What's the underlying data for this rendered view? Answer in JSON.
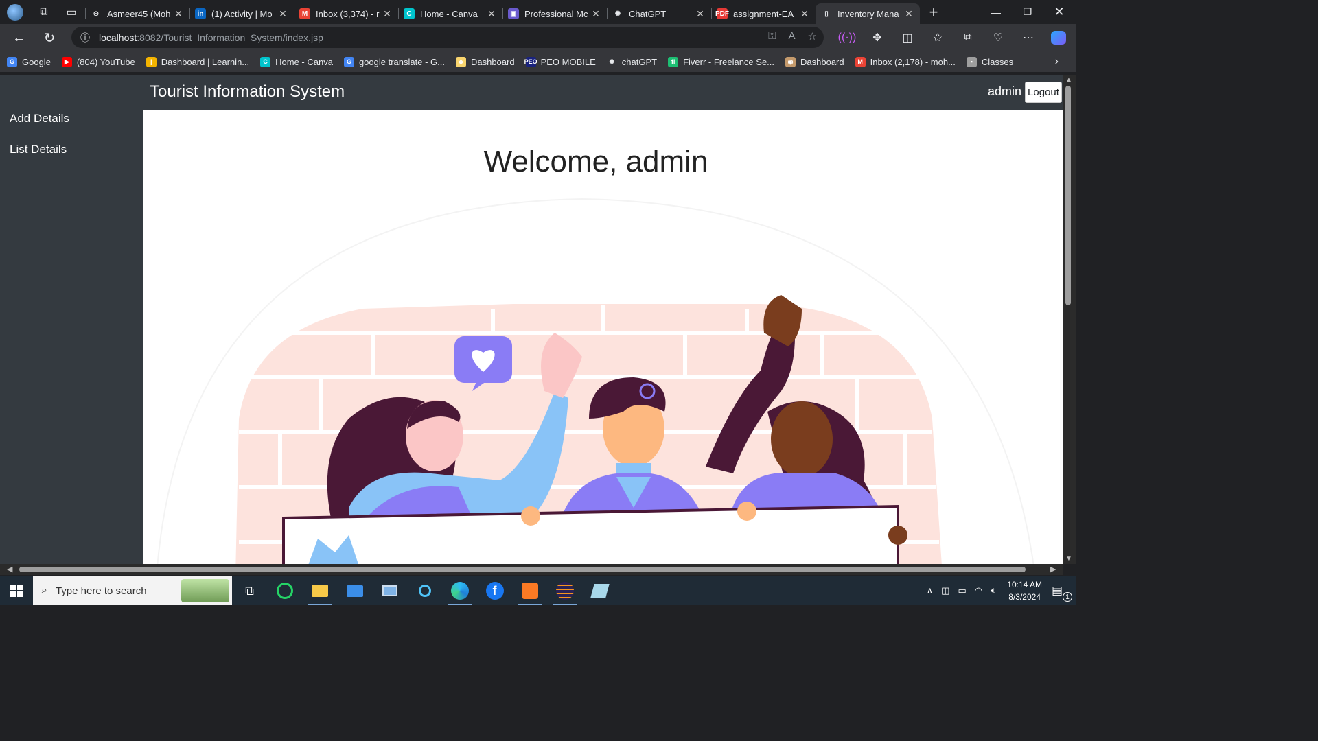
{
  "browser": {
    "tabs": [
      {
        "title": "Asmeer45 (Moh",
        "favicon_color": "#ffffff",
        "glyph": "⊙"
      },
      {
        "title": "(1) Activity | Mo",
        "favicon_color": "#0a66c2",
        "glyph": "in"
      },
      {
        "title": "Inbox (3,374) - r",
        "favicon_color": "#ea4335",
        "glyph": "M"
      },
      {
        "title": "Home - Canva",
        "favicon_color": "#00c4cc",
        "glyph": "C"
      },
      {
        "title": "Professional Mc",
        "favicon_color": "#6a5acd",
        "glyph": "▣"
      },
      {
        "title": "ChatGPT",
        "favicon_color": "#ffffff",
        "glyph": "✺"
      },
      {
        "title": "assignment-EA",
        "favicon_color": "#e53935",
        "glyph": "PDF"
      },
      {
        "title": "Inventory Mana",
        "favicon_color": "#e8eaed",
        "glyph": "▯",
        "active": true
      }
    ],
    "url_host": "localhost",
    "url_path": ":8082/Tourist_Information_System/index.jsp",
    "bookmarks": [
      {
        "label": "Google",
        "color": "#4285f4",
        "glyph": "G"
      },
      {
        "label": "(804) YouTube",
        "color": "#ff0000",
        "glyph": "▶"
      },
      {
        "label": "Dashboard | Learnin...",
        "color": "#f4b400",
        "glyph": "|"
      },
      {
        "label": "Home - Canva",
        "color": "#00c4cc",
        "glyph": "C"
      },
      {
        "label": "google translate - G...",
        "color": "#4285f4",
        "glyph": "G"
      },
      {
        "label": "Dashboard",
        "color": "#f9d56e",
        "glyph": "◈"
      },
      {
        "label": "PEO MOBILE",
        "color": "#1a237e",
        "glyph": "PEO"
      },
      {
        "label": "chatGPT",
        "color": "#ffffff",
        "glyph": "✺"
      },
      {
        "label": "Fiverr - Freelance Se...",
        "color": "#1dbf73",
        "glyph": "fi"
      },
      {
        "label": "Dashboard",
        "color": "#c49a6c",
        "glyph": "◉"
      },
      {
        "label": "Inbox (2,178) - moh...",
        "color": "#ea4335",
        "glyph": "M"
      },
      {
        "label": "Classes",
        "color": "#9e9e9e",
        "glyph": "▪"
      }
    ]
  },
  "app": {
    "brand": "Tourist Information System",
    "user": "admin",
    "logout_label": "Logout",
    "sidebar": [
      {
        "label": "Add Details"
      },
      {
        "label": "List Details"
      }
    ],
    "welcome": "Welcome, admin"
  },
  "taskbar": {
    "search_placeholder": "Type here to search",
    "time": "10:14 AM",
    "date": "8/3/2024",
    "notification_count": "1"
  }
}
